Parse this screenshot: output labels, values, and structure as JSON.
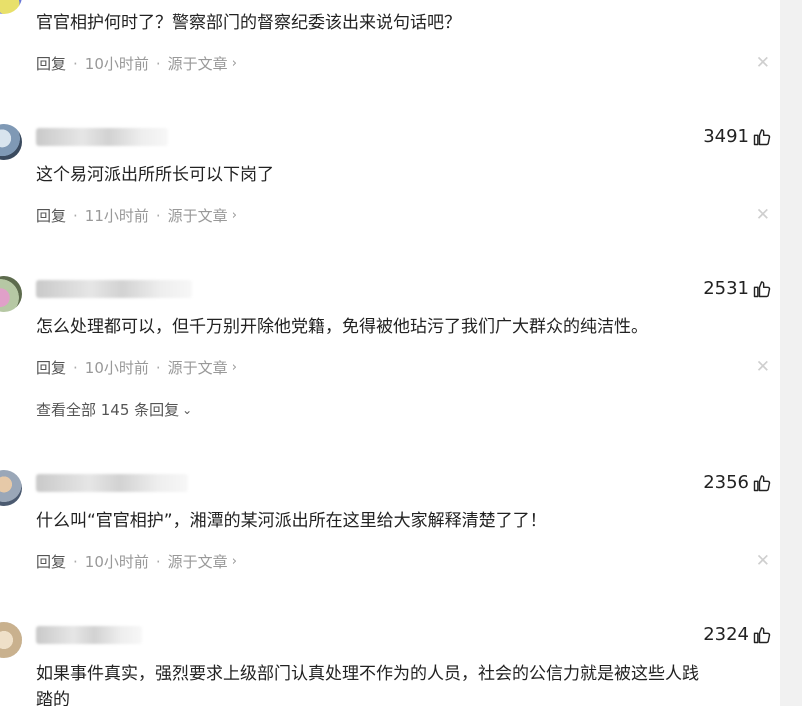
{
  "colors": {
    "accent": "#222222",
    "meta": "#999999",
    "close": "#cfcfcf"
  },
  "comments": [
    {
      "text": "官官相护何时了？警察部门的督察纪委该出来说句话吧？",
      "meta": {
        "reply": "回复",
        "time": "10小时前",
        "source": "源于文章"
      }
    },
    {
      "likes": "3491",
      "text": "这个易河派出所所长可以下岗了",
      "meta": {
        "reply": "回复",
        "time": "11小时前",
        "source": "源于文章"
      }
    },
    {
      "likes": "2531",
      "text": "怎么处理都可以，但千万别开除他党籍，免得被他玷污了我们广大群众的纯洁性。",
      "meta": {
        "reply": "回复",
        "time": "10小时前",
        "source": "源于文章"
      },
      "view_all": "查看全部 145 条回复"
    },
    {
      "likes": "2356",
      "text": "什么叫“官官相护”，湘潭的某河派出所在这里给大家解释清楚了了！",
      "meta": {
        "reply": "回复",
        "time": "10小时前",
        "source": "源于文章"
      }
    },
    {
      "likes": "2324",
      "text": "如果事件真实，强烈要求上级部门认真处理不作为的人员，社会的公信力就是被这些人践",
      "text2": "踏的"
    }
  ],
  "icons": {
    "like": "thumbs-up-icon",
    "close": "close-icon",
    "chevron": "chevron-right-icon",
    "expand": "chevron-down-icon"
  }
}
